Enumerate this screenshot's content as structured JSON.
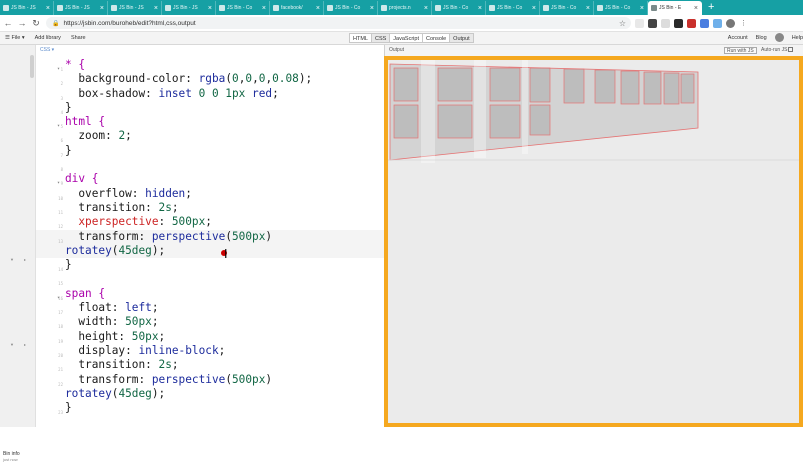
{
  "browser": {
    "tabs": [
      {
        "title": "JS Bin - JS",
        "active": false
      },
      {
        "title": "JS Bin - JS",
        "active": false
      },
      {
        "title": "JS Bin - JS",
        "active": false
      },
      {
        "title": "JS Bin - JS",
        "active": false
      },
      {
        "title": "JS Bin - Co",
        "active": false
      },
      {
        "title": "facebook/",
        "active": false
      },
      {
        "title": "JS Bin - Co",
        "active": false
      },
      {
        "title": "projects.n",
        "active": false
      },
      {
        "title": "JS Bin - Co",
        "active": false
      },
      {
        "title": "JS Bin - Co",
        "active": false
      },
      {
        "title": "JS Bin - Co",
        "active": false
      },
      {
        "title": "JS Bin - Co",
        "active": false
      },
      {
        "title": "JS Bin - E",
        "active": true
      }
    ],
    "new_tab": "+",
    "url": "https://jsbin.com/buroheb/edit?html,css,output",
    "colors": {
      "tabstrip": "#16a0a4",
      "output_border": "#f5a81f"
    }
  },
  "jsbin": {
    "file_menu": "File",
    "add_library": "Add library",
    "share": "Share",
    "panels": [
      "HTML",
      "CSS",
      "JavaScript",
      "Console",
      "Output"
    ],
    "active_panels": [
      "CSS",
      "Output"
    ],
    "account": "Account",
    "blog": "Blog",
    "help": "Help",
    "css_panel_title": "CSS",
    "output_label": "Output",
    "run_button": "Run with JS",
    "auto_run": "Auto-run JS",
    "bin_info": "Bin info",
    "bin_info_sub": "just now"
  },
  "code_lines": [
    {
      "n": "1",
      "fold": true,
      "parts": [
        [
          "sel",
          "* {"
        ]
      ]
    },
    {
      "n": "2",
      "fold": false,
      "parts": [
        [
          "prop",
          "  background-color: "
        ],
        [
          "val",
          "rgba"
        ],
        [
          "prop",
          "("
        ],
        [
          "num",
          "0"
        ],
        [
          "prop",
          ","
        ],
        [
          "num",
          "0"
        ],
        [
          "prop",
          ","
        ],
        [
          "num",
          "0"
        ],
        [
          "prop",
          ","
        ],
        [
          "num",
          "0.08"
        ],
        [
          "prop",
          ");"
        ]
      ]
    },
    {
      "n": "3",
      "fold": false,
      "parts": [
        [
          "prop",
          "  box-shadow: "
        ],
        [
          "val",
          "inset "
        ],
        [
          "num",
          "0 0 1px "
        ],
        [
          "val",
          "red"
        ],
        [
          "prop",
          ";"
        ]
      ]
    },
    {
      "n": "4",
      "fold": false,
      "parts": [
        [
          "prop",
          "}"
        ]
      ]
    },
    {
      "n": "5",
      "fold": true,
      "parts": [
        [
          "sel",
          "html {"
        ]
      ]
    },
    {
      "n": "6",
      "fold": false,
      "parts": [
        [
          "prop",
          "  zoom: "
        ],
        [
          "num",
          "2"
        ],
        [
          "prop",
          ";"
        ]
      ]
    },
    {
      "n": "7",
      "fold": false,
      "parts": [
        [
          "prop",
          "}"
        ]
      ]
    },
    {
      "n": "8",
      "fold": false,
      "parts": [
        [
          "prop",
          ""
        ]
      ]
    },
    {
      "n": "9",
      "fold": true,
      "parts": [
        [
          "sel",
          "div {"
        ]
      ]
    },
    {
      "n": "10",
      "fold": false,
      "parts": [
        [
          "prop",
          "  overflow: "
        ],
        [
          "val",
          "hidden"
        ],
        [
          "prop",
          ";"
        ]
      ]
    },
    {
      "n": "11",
      "fold": false,
      "parts": [
        [
          "prop",
          "  transition: "
        ],
        [
          "num",
          "2s"
        ],
        [
          "prop",
          ";"
        ]
      ]
    },
    {
      "n": "12",
      "fold": false,
      "parts": [
        [
          "err",
          "  xperspective"
        ],
        [
          "prop",
          ": "
        ],
        [
          "num",
          "500px"
        ],
        [
          "prop",
          ";"
        ]
      ]
    },
    {
      "n": "13",
      "fold": false,
      "hl": true,
      "parts": [
        [
          "prop",
          "  transform: "
        ],
        [
          "val",
          "perspective"
        ],
        [
          "prop",
          "("
        ],
        [
          "num",
          "500px"
        ],
        [
          "prop",
          ")"
        ]
      ]
    },
    {
      "n": "",
      "fold": false,
      "hl": true,
      "wrap": true,
      "parts": [
        [
          "val",
          "rotatey"
        ],
        [
          "prop",
          "("
        ],
        [
          "num",
          "45deg"
        ],
        [
          "prop",
          ");"
        ]
      ]
    },
    {
      "n": "14",
      "fold": false,
      "parts": [
        [
          "prop",
          "}"
        ]
      ]
    },
    {
      "n": "15",
      "fold": false,
      "parts": [
        [
          "prop",
          ""
        ]
      ]
    },
    {
      "n": "16",
      "fold": true,
      "parts": [
        [
          "sel",
          "span {"
        ]
      ]
    },
    {
      "n": "17",
      "fold": false,
      "parts": [
        [
          "prop",
          "  float: "
        ],
        [
          "val",
          "left"
        ],
        [
          "prop",
          ";"
        ]
      ]
    },
    {
      "n": "18",
      "fold": false,
      "parts": [
        [
          "prop",
          "  width: "
        ],
        [
          "num",
          "50px"
        ],
        [
          "prop",
          ";"
        ]
      ]
    },
    {
      "n": "19",
      "fold": false,
      "parts": [
        [
          "prop",
          "  height: "
        ],
        [
          "num",
          "50px"
        ],
        [
          "prop",
          ";"
        ]
      ]
    },
    {
      "n": "20",
      "fold": false,
      "parts": [
        [
          "prop",
          "  display: "
        ],
        [
          "val",
          "inline-block"
        ],
        [
          "prop",
          ";"
        ]
      ]
    },
    {
      "n": "21",
      "fold": false,
      "parts": [
        [
          "prop",
          "  transition: "
        ],
        [
          "num",
          "2s"
        ],
        [
          "prop",
          ";"
        ]
      ]
    },
    {
      "n": "22",
      "fold": false,
      "parts": [
        [
          "prop",
          "  transform: "
        ],
        [
          "val",
          "perspective"
        ],
        [
          "prop",
          "("
        ],
        [
          "num",
          "500px"
        ],
        [
          "prop",
          ")"
        ]
      ]
    },
    {
      "n": "",
      "fold": false,
      "wrap": true,
      "parts": [
        [
          "val",
          "rotatey"
        ],
        [
          "prop",
          "("
        ],
        [
          "num",
          "45deg"
        ],
        [
          "prop",
          ");"
        ]
      ]
    },
    {
      "n": "23",
      "fold": false,
      "parts": [
        [
          "prop",
          "}"
        ]
      ]
    }
  ]
}
